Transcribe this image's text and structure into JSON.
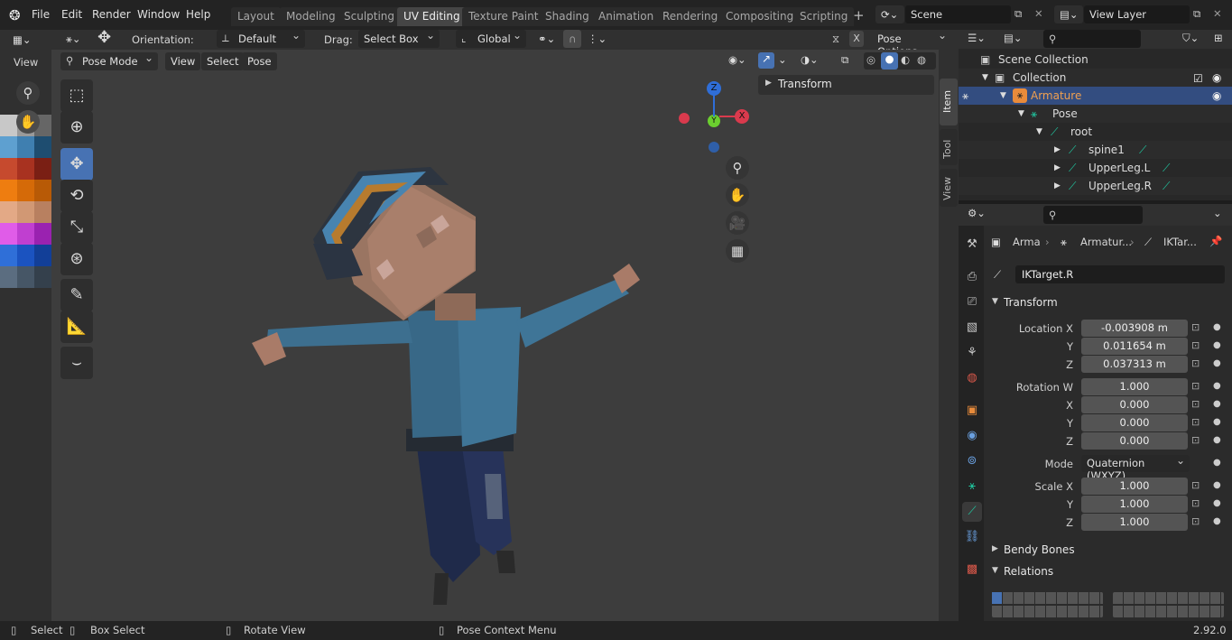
{
  "menu": {
    "file": "File",
    "edit": "Edit",
    "render": "Render",
    "window": "Window",
    "help": "Help"
  },
  "tabs": [
    "Layout",
    "Modeling",
    "Sculpting",
    "UV Editing",
    "Texture Paint",
    "Shading",
    "Animation",
    "Rendering",
    "Compositing",
    "Scripting"
  ],
  "scene": {
    "name": "Scene",
    "view_layer": "View Layer"
  },
  "toolbar": {
    "orientation_label": "Orientation:",
    "orientation_value": "Default",
    "drag_label": "Drag:",
    "drag_value": "Select Box",
    "transform_space": "Global",
    "pose_options": "Pose Options"
  },
  "left_panel": {
    "view": "View"
  },
  "viewport_header": {
    "mode": "Pose Mode",
    "view": "View",
    "select": "Select",
    "pose": "Pose"
  },
  "sidebar": {
    "transform": "Transform",
    "tabs": [
      "Item",
      "Tool",
      "View"
    ]
  },
  "gizmo": {
    "z": "Z",
    "x": "X",
    "y": "Y"
  },
  "outliner": {
    "rows": [
      "Scene Collection",
      "Collection",
      "Armature",
      "Pose",
      "root",
      "spine1",
      "UpperLeg.L",
      "UpperLeg.R"
    ]
  },
  "properties": {
    "breadcrumb": [
      "Arma",
      "Armatur...",
      "IKTar..."
    ],
    "bone_name": "IKTarget.R",
    "transform_title": "Transform",
    "location_label": "Location X",
    "y": "Y",
    "z": "Z",
    "x": "X",
    "w_label": "Rotation W",
    "location": [
      "-0.003908 m",
      "0.011654 m",
      "0.037313 m"
    ],
    "rotation": [
      "1.000",
      "0.000",
      "0.000",
      "0.000"
    ],
    "mode_label": "Mode",
    "mode_value": "Quaternion (WXYZ)",
    "scale_label": "Scale X",
    "scale": [
      "1.000",
      "1.000",
      "1.000"
    ],
    "bendy": "Bendy Bones",
    "relations": "Relations"
  },
  "status": {
    "select": "Select",
    "box_select": "Box Select",
    "rotate": "Rotate View",
    "context": "Pose Context Menu",
    "version": "2.92.0"
  },
  "colors": {
    "accent": "#4772b3",
    "armature_orange": "#e88b3b",
    "bone_green": "#20c7a0"
  }
}
